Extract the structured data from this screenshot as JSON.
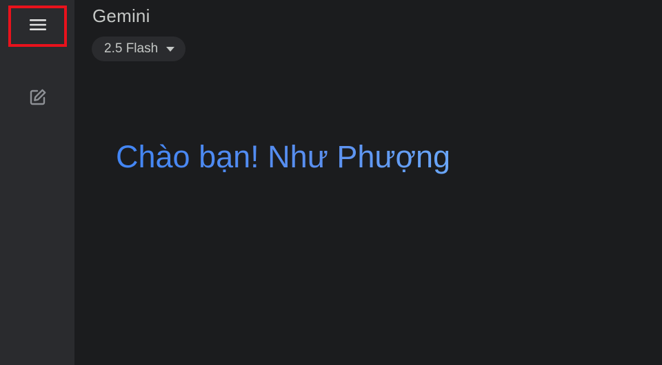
{
  "app": {
    "title": "Gemini"
  },
  "model_selector": {
    "label": "2.5 Flash",
    "icon": "caret-down-icon"
  },
  "sidebar": {
    "menu_icon": "hamburger-menu-icon",
    "new_chat_icon": "edit-square-icon"
  },
  "main": {
    "greeting": "Chào bạn! Như Phượng"
  },
  "colors": {
    "background": "#1b1c1e",
    "sidebar": "#2a2b2e",
    "highlight_box": "#e8121c",
    "greeting_blue": "#4285f4"
  }
}
